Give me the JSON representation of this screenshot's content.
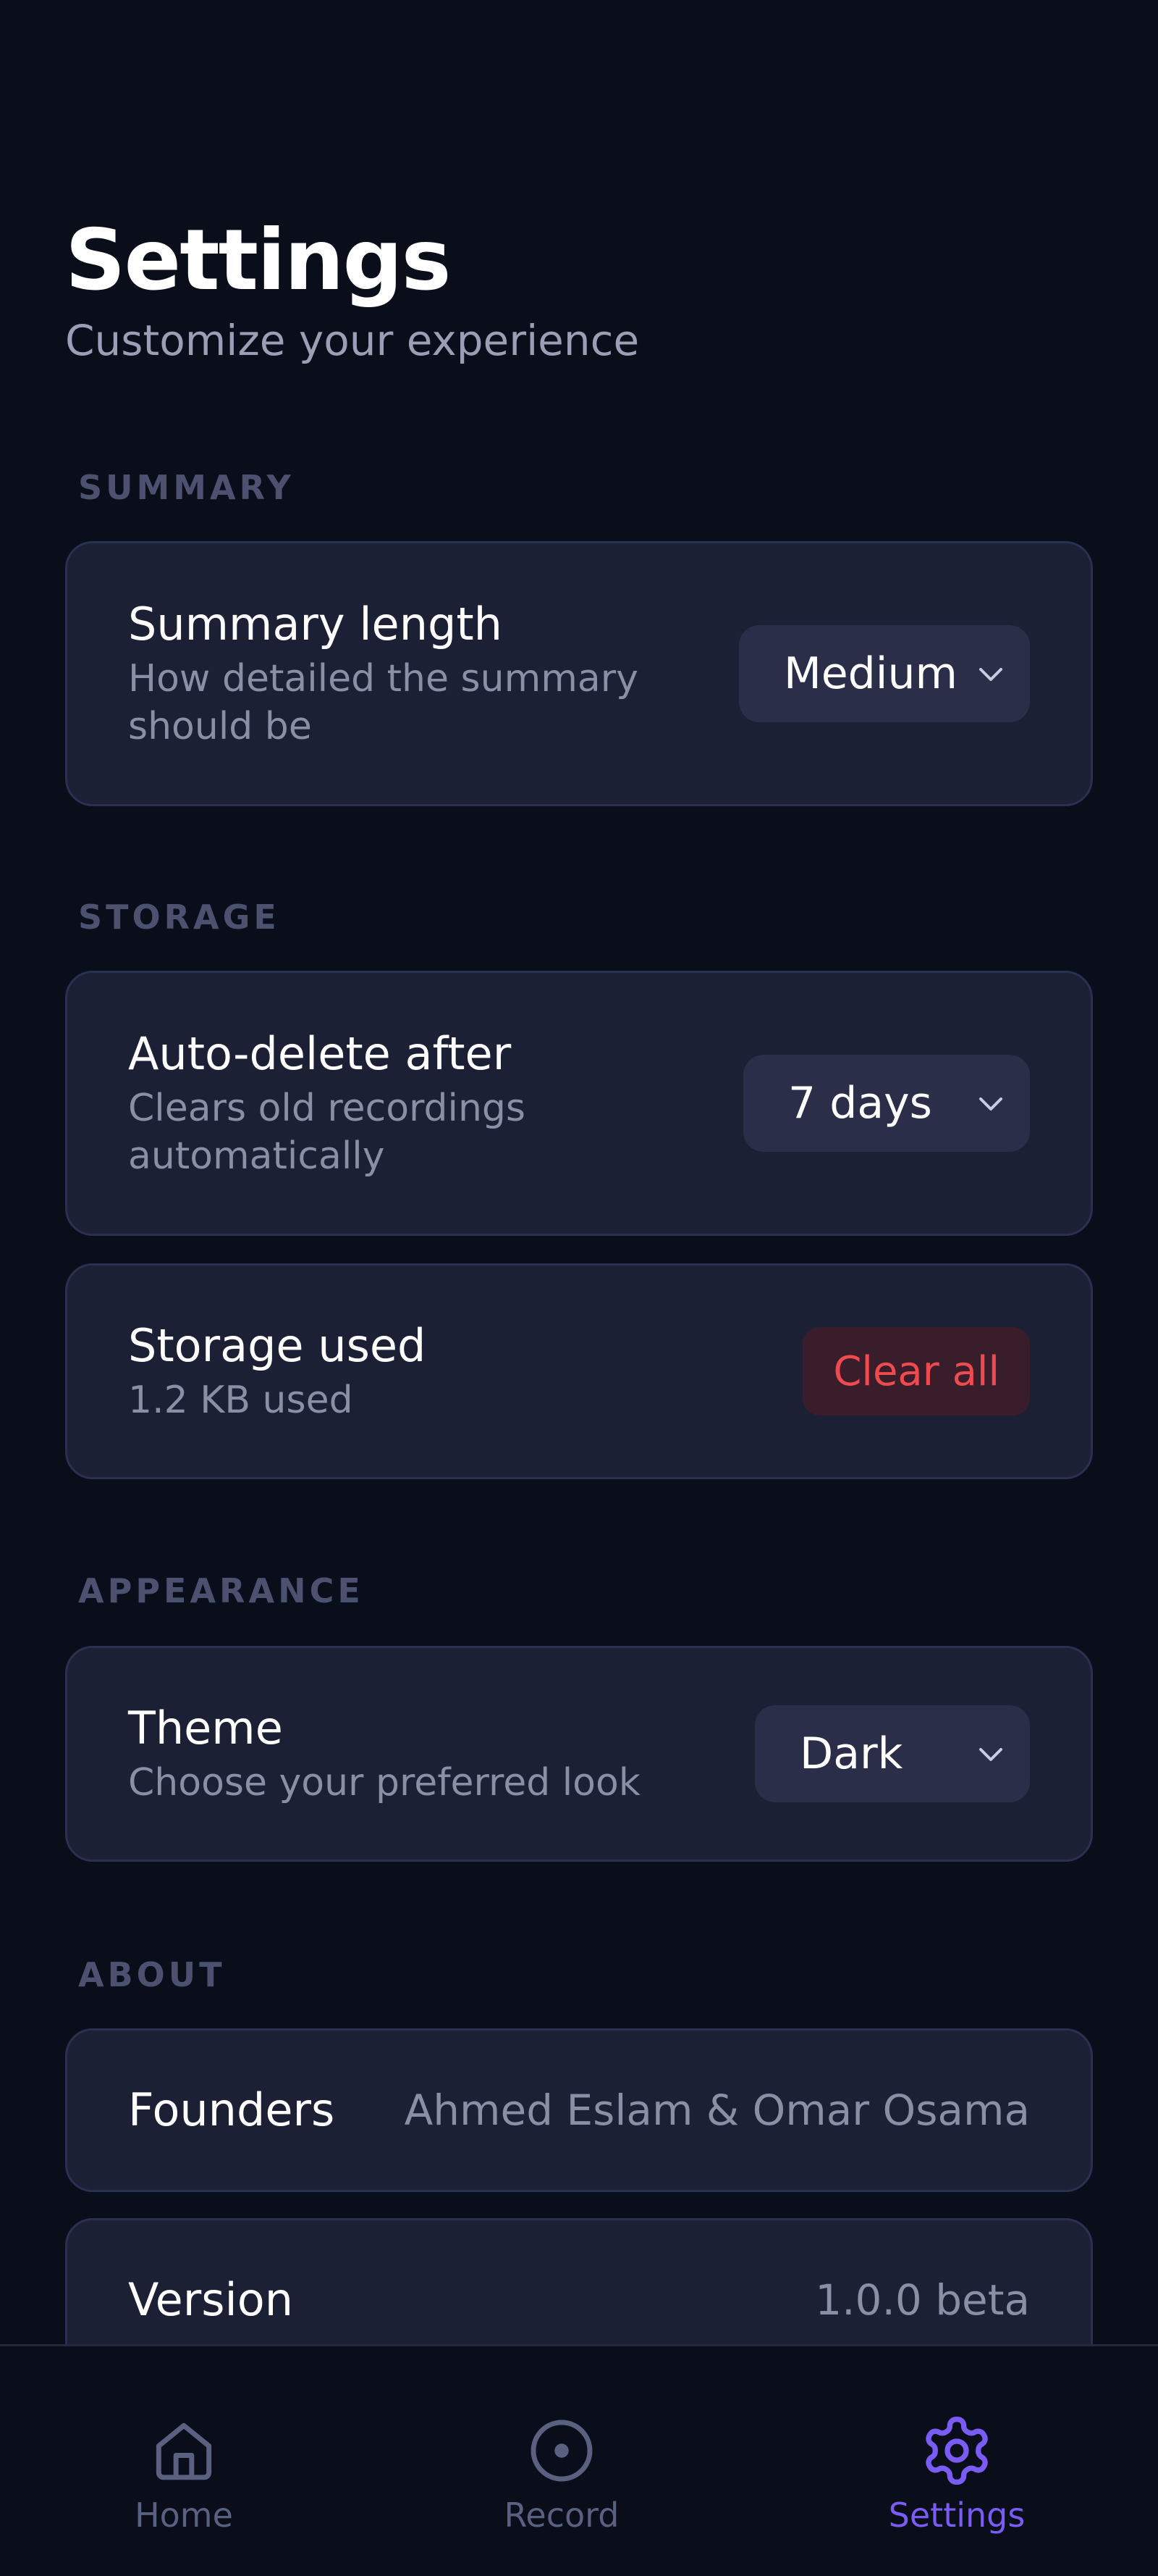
{
  "header": {
    "title": "Settings",
    "subtitle": "Customize your experience"
  },
  "sections": {
    "summary": {
      "label": "SUMMARY",
      "summary_length": {
        "title": "Summary length",
        "desc_line1": "How detailed the summary",
        "desc_line2": "should be",
        "value": "Medium"
      }
    },
    "storage": {
      "label": "STORAGE",
      "auto_delete": {
        "title": "Auto-delete after",
        "desc_line1": "Clears old recordings",
        "desc_line2": "automatically",
        "value": "7 days"
      },
      "storage_used": {
        "title": "Storage used",
        "desc": "1.2 KB used",
        "button": "Clear all"
      }
    },
    "appearance": {
      "label": "APPEARANCE",
      "theme": {
        "title": "Theme",
        "desc": "Choose your preferred look",
        "value": "Dark"
      }
    },
    "about": {
      "label": "ABOUT",
      "founders": {
        "title": "Founders",
        "value": "Ahmed Eslam & Omar Osama"
      },
      "version": {
        "title": "Version",
        "value": "1.0.0 beta"
      }
    }
  },
  "nav": {
    "items": [
      {
        "label": "Home",
        "icon": "home-icon",
        "active": false
      },
      {
        "label": "Record",
        "icon": "record-icon",
        "active": false
      },
      {
        "label": "Settings",
        "icon": "gear-icon",
        "active": true
      }
    ]
  },
  "colors": {
    "background": "#0a0d1a",
    "card": "#1c2035",
    "accent": "#7a5cf5",
    "danger": "#ef4a4f",
    "muted": "#8a8fa6"
  }
}
